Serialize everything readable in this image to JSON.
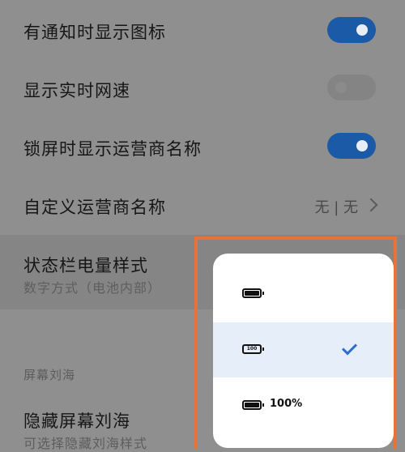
{
  "settings": {
    "notif_icons": {
      "label": "有通知时显示图标",
      "enabled": true
    },
    "net_speed": {
      "label": "显示实时网速",
      "enabled": false
    },
    "carrier_lock": {
      "label": "锁屏时显示运营商名称",
      "enabled": true
    },
    "custom_carrier": {
      "label": "自定义运营商名称",
      "value": "无 | 无"
    },
    "battery_style": {
      "label": "状态栏电量样式",
      "subtitle": "数字方式（电池内部）"
    },
    "section_notch": "屏幕刘海",
    "hide_notch": {
      "label": "隐藏屏幕刘海",
      "subtitle": "可选择隐藏刘海样式"
    }
  },
  "battery_popup": {
    "options": [
      {
        "icon": "battery-icon",
        "text": "",
        "selected": false
      },
      {
        "icon": "battery-number-inside-icon",
        "text": "100",
        "selected": true
      },
      {
        "icon": "battery-with-percent-icon",
        "text": "100%",
        "selected": false
      }
    ]
  },
  "colors": {
    "accent": "#1a5aa6",
    "highlight_border": "#e8733a",
    "check": "#2a6fd6"
  }
}
